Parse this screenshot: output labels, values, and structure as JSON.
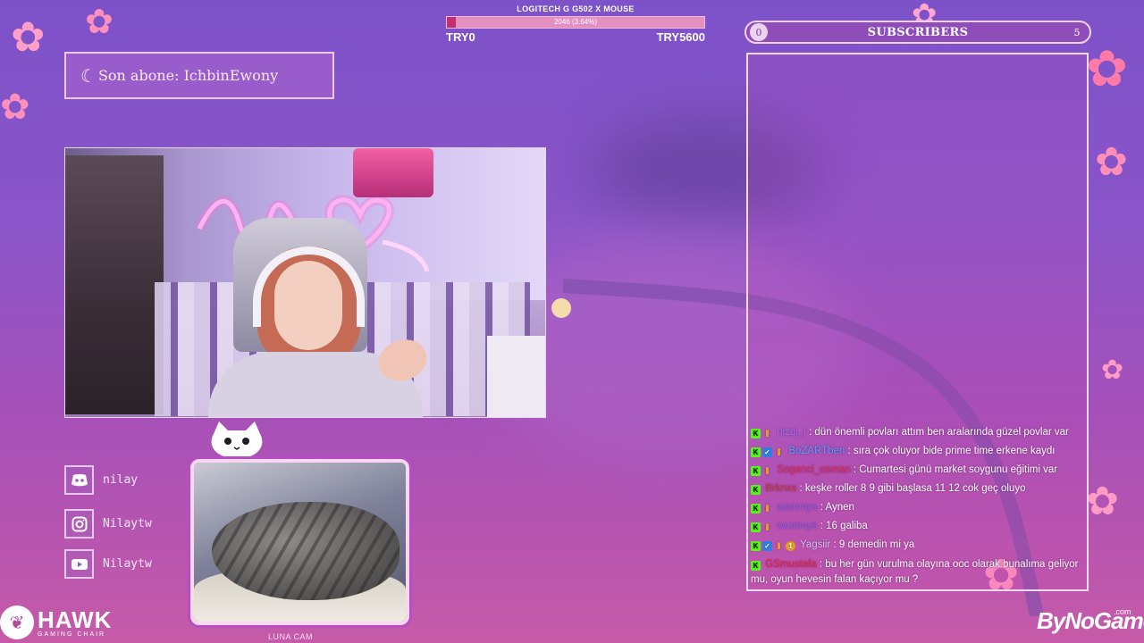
{
  "goal": {
    "title": "LOGITECH G G502 X MOUSE",
    "progress_text": "2046 (3.64%)",
    "progress_fraction": 0.0364,
    "min_label": "TRY0",
    "max_label": "TRY5600"
  },
  "last_sub": {
    "icon": "crescent-moon-icon",
    "text": "Son abone: IchbinEwony"
  },
  "social": [
    {
      "icon": "discord-icon",
      "label": "nilay"
    },
    {
      "icon": "instagram-icon",
      "label": "Nilaytw"
    },
    {
      "icon": "youtube-icon",
      "label": "Nilaytw"
    }
  ],
  "luna_cam": {
    "caption": "LUNA CAM"
  },
  "subscribers": {
    "title": "SUBSCRIBERS",
    "current": "0",
    "goal": "5"
  },
  "chat": {
    "messages": [
      {
        "badges": [
          "k",
          "b"
        ],
        "user": "nizqi_i",
        "color": "#9b6fe8",
        "text": ": dün önemli povları attım ben aralarında güzel povlar var"
      },
      {
        "badges": [
          "k",
          "s",
          "b"
        ],
        "user": "BoZARTben",
        "color": "#4aa3ff",
        "text": ": sıra çok oluyor bide prime time erkene kaydı"
      },
      {
        "badges": [
          "k",
          "b"
        ],
        "user": "Soganci_osman",
        "color": "#e02a4e",
        "text": ": Cumartesi günü market soygunu eğitimi var"
      },
      {
        "badges": [
          "k"
        ],
        "user": "Brknxs",
        "color": "#c33a3a",
        "text": ": keşke roller 8 9 gibi başlasa 11 12 cok geç oluyo"
      },
      {
        "badges": [
          "k",
          "b"
        ],
        "user": "wommys",
        "color": "#8e5fe6",
        "text": ": Aynen"
      },
      {
        "badges": [
          "k",
          "b"
        ],
        "user": "wommys",
        "color": "#8e5fe6",
        "text": ": 16 galiba"
      },
      {
        "badges": [
          "k",
          "s",
          "b",
          "g"
        ],
        "user": "Yagsiir",
        "color": "#cfc4f3",
        "text": ": 9 demedin mi ya"
      },
      {
        "badges": [
          "k"
        ],
        "user": "GSmustafa",
        "color": "#e3263d",
        "text": ": bu her gün vurulma olayına ooc olarak bunalıma geliyor mu, oyun hevesin falan kaçıyor mu ?"
      }
    ]
  },
  "brands": {
    "hawk_name": "HAWK",
    "hawk_sub": "GAMING CHAIR",
    "bynogame": "ByNoGame",
    "bynogame_sup": ".com"
  },
  "colors": {
    "goal_fill": "#c2316f",
    "accent_pink": "#f0c7e8",
    "kick_green": "#53fc18"
  }
}
